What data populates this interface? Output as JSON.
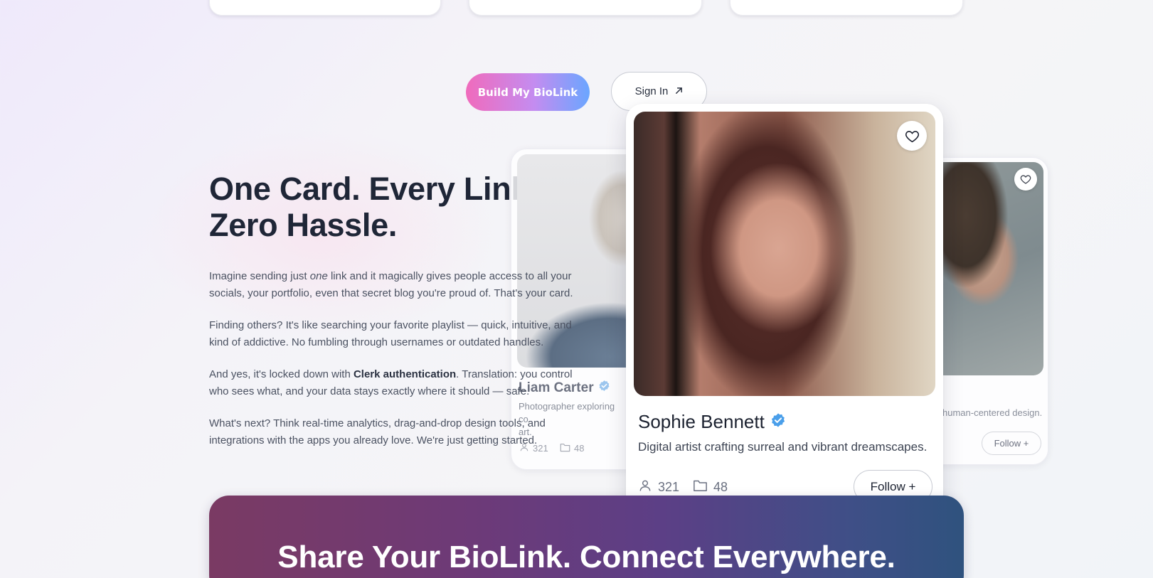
{
  "actions": {
    "primary_label": "Build My BioLink",
    "secondary_label": "Sign In",
    "secondary_icon": "arrow-up-right-icon"
  },
  "hero": {
    "headline_line1": "One Card. Every Link.",
    "headline_line2": "Zero Hassle.",
    "p1_a": "Imagine sending just ",
    "p1_em": "one",
    "p1_b": " link and it magically gives people access to all your socials, your portfolio, even that secret blog you're proud of. That's your card.",
    "p2": "Finding others? It's like searching your favorite playlist — quick, intuitive, and kind of addictive. No fumbling through usernames or outdated handles.",
    "p3_a": "And yes, it's locked down with ",
    "p3_strong": "Clerk authentication",
    "p3_b": ". Translation: you control who sees what, and your data stays exactly where it should — safe.",
    "p4": "What's next? Think real-time analytics, drag-and-drop design tools, and integrations with the apps you already love. We're just getting started."
  },
  "cards": {
    "main": {
      "name": "Sophie Bennett",
      "bio": "Digital artist crafting surreal and vibrant dreamscapes.",
      "followers": "321",
      "projects": "48",
      "follow_label": "Follow +"
    },
    "left": {
      "name": "Liam Carter",
      "bio_line1": "Photographer exploring co",
      "bio_line2": "art.",
      "followers": "321",
      "projects": "48"
    },
    "right": {
      "bio": "human-centered design.",
      "follow_label": "Follow +"
    }
  },
  "banner": {
    "title": "Share Your BioLink. Connect Everywhere."
  },
  "colors": {
    "gradient_start": "#f06bbc",
    "gradient_mid": "#c48cf0",
    "gradient_end": "#6aa6ff",
    "verified": "#4a9fea",
    "banner_start": "#7a3a63",
    "banner_end": "#2f527e"
  }
}
